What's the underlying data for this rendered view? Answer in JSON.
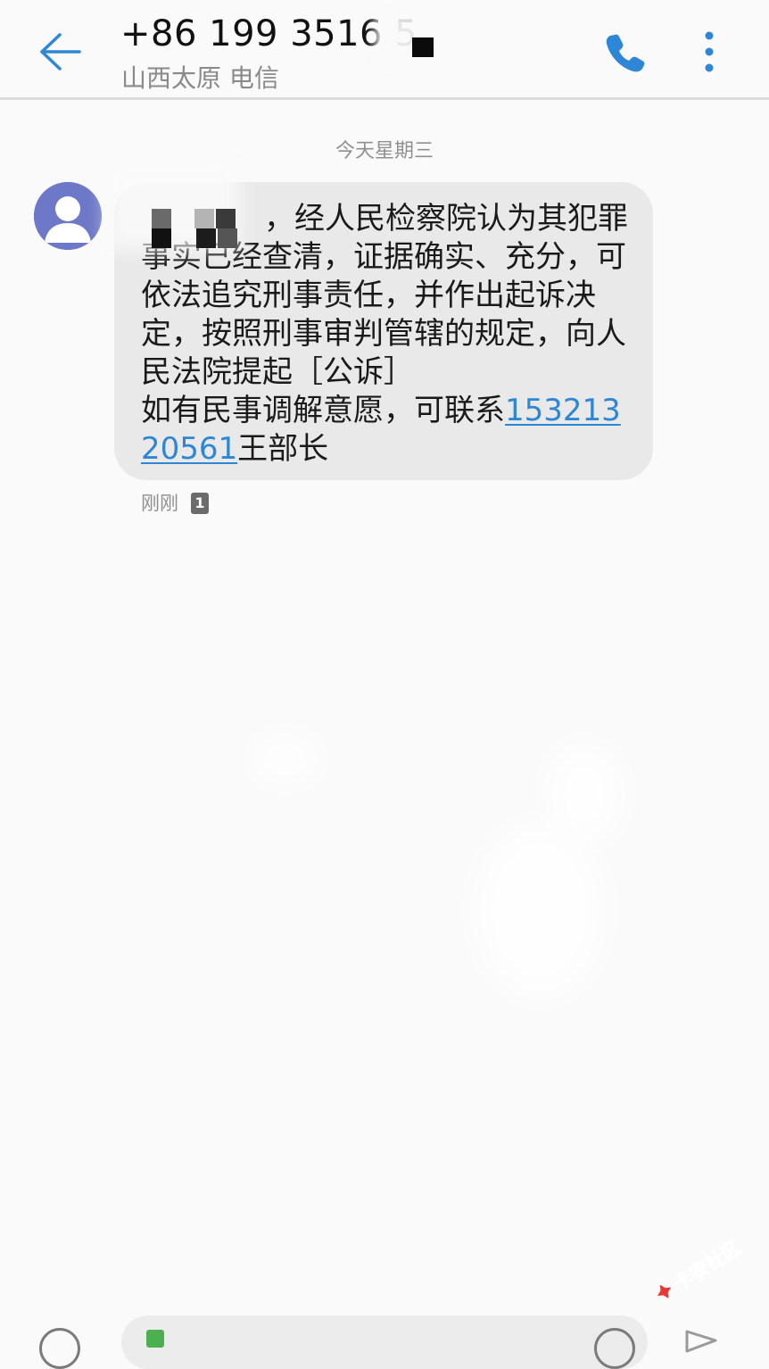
{
  "header": {
    "title": "+86 199 3516 5",
    "subtitle": "山西太原 电信",
    "accent_color": "#2d86d6",
    "back_icon": "arrow-left-icon",
    "call_icon": "phone-icon",
    "more_icon": "more-vertical-icon"
  },
  "conversation": {
    "date_label": "今天星期三",
    "message": {
      "text": "，经人民检察院认为其犯罪事实已经查清，证据确实、充分，可依法追究刑事责任，并作出起诉决定，按照刑事审判管辖的规定，向人民法院提起［公诉］\n如有民事调解意愿，可联系",
      "phone_link": "15321320561",
      "text_after_link": "王部长",
      "time": "刚刚",
      "sim_badge": "1",
      "bubble_color": "#e9e9e9"
    },
    "avatar_icon": "person-icon"
  },
  "compose": {
    "attach_icon": "add-circle-icon",
    "sim_icon": "sim-card-icon",
    "emoji_icon": "emoji-icon",
    "send_icon": "send-icon"
  },
  "watermark": {
    "text": "卡农社区"
  }
}
